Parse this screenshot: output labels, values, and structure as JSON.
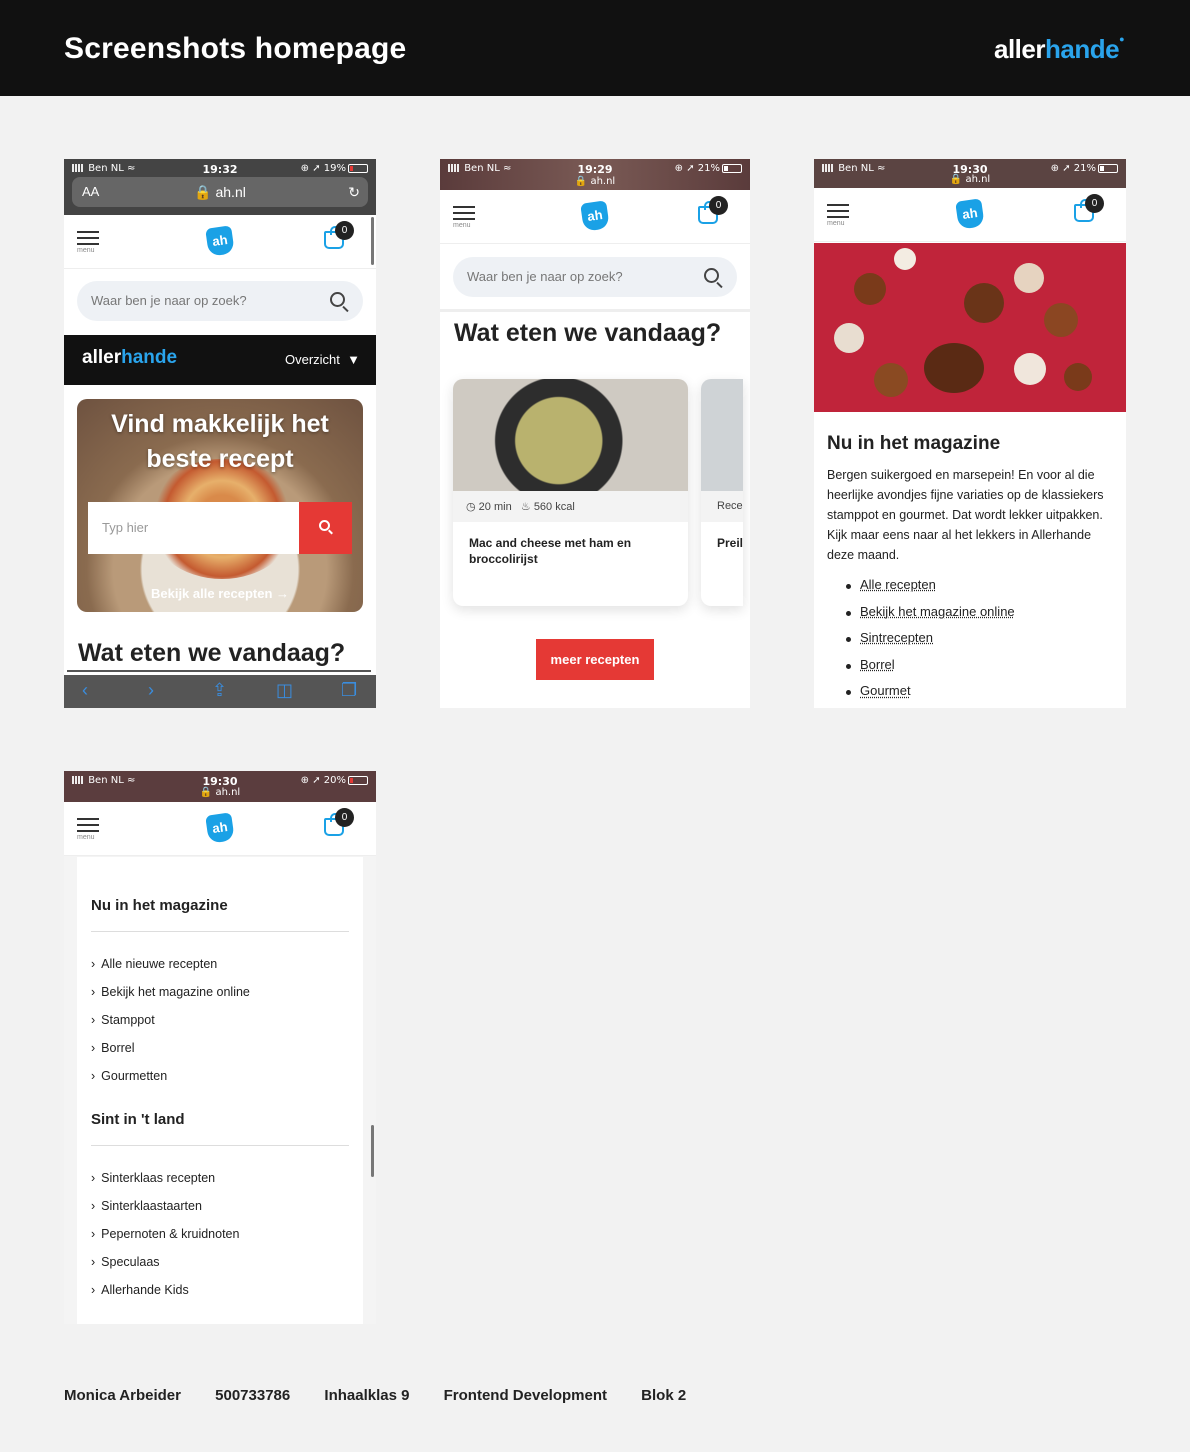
{
  "page": {
    "title": "Screenshots homepage",
    "brand_a": "aller",
    "brand_b": "hande"
  },
  "phone1": {
    "carrier": "Ben NL",
    "time": "19:32",
    "battery": "19%",
    "aa": "AA",
    "url": "ah.nl",
    "menu": "menu",
    "cart_count": "0",
    "search_placeholder": "Waar ben je naar op zoek?",
    "allerhande_a": "aller",
    "allerhande_b": "hande",
    "overview": "Overzicht",
    "hero_title": "Vind makkelijk het beste recept",
    "hero_input_placeholder": "Typ hier",
    "hero_link": "Bekijk alle recepten",
    "heading": "Wat eten we vandaag?"
  },
  "phone2": {
    "carrier": "Ben NL",
    "time": "19:29",
    "battery": "21%",
    "url": "ah.nl",
    "menu": "menu",
    "cart_count": "0",
    "search_placeholder": "Waar ben je naar op zoek?",
    "heading": "Wat eten we vandaag?",
    "cards": [
      {
        "time": "20 min",
        "kcal": "560 kcal",
        "name": "Mac and cheese met ham en broccolirijst"
      },
      {
        "meta": "Recep",
        "name": "Preil"
      }
    ],
    "button": "meer recepten"
  },
  "phone3": {
    "carrier": "Ben NL",
    "time": "19:30",
    "battery": "21%",
    "url": "ah.nl",
    "menu": "menu",
    "cart_count": "0",
    "heading": "Nu in het magazine",
    "text": "Bergen suikergoed en marsepein! En voor al die heerlijke avondjes fijne variaties op de klassiekers stamppot en gourmet. Dat wordt lekker uitpakken. Kijk maar eens naar al het lekkers in Allerhande deze maand.",
    "links": [
      "Alle recepten",
      "Bekijk het magazine online",
      "Sintrecepten",
      "Borrel",
      "Gourmet"
    ]
  },
  "phone4": {
    "carrier": "Ben NL",
    "time": "19:30",
    "battery": "20%",
    "url": "ah.nl",
    "menu": "menu",
    "cart_count": "0",
    "section1": "Nu in het magazine",
    "items1": [
      "Alle nieuwe recepten",
      "Bekijk het magazine online",
      "Stamppot",
      "Borrel",
      "Gourmetten"
    ],
    "section2": "Sint in 't land",
    "items2": [
      "Sinterklaas recepten",
      "Sinterklaastaarten",
      "Pepernoten & kruidnoten",
      "Speculaas",
      "Allerhande Kids"
    ]
  },
  "footer": {
    "name": "Monica Arbeider",
    "student_number": "500733786",
    "class": "Inhaalklas 9",
    "course": "Frontend Development",
    "block": "Blok 2"
  },
  "colors": {
    "accent": "#1aa1e6",
    "red": "#e53935",
    "dark": "#111111"
  }
}
